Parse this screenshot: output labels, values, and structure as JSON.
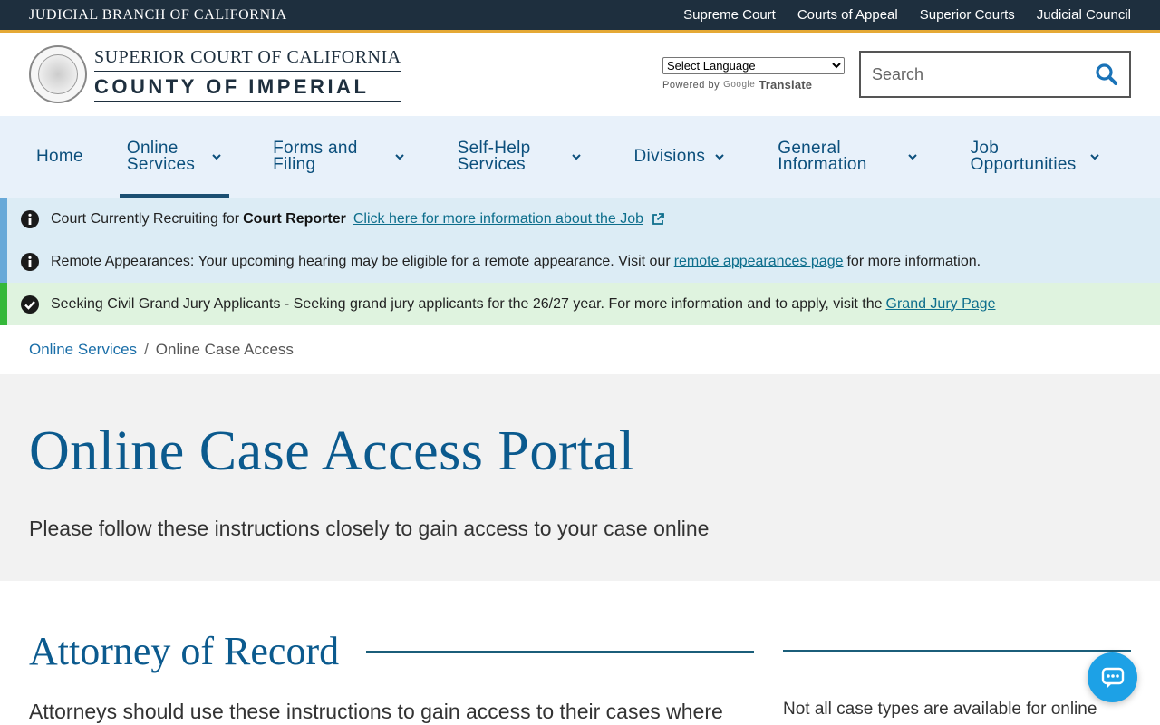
{
  "topbar": {
    "brand": "JUDICIAL BRANCH OF CALIFORNIA",
    "links": [
      "Supreme Court",
      "Courts of Appeal",
      "Superior Courts",
      "Judicial Council"
    ]
  },
  "header": {
    "logo_line1": "SUPERIOR COURT OF CALIFORNIA",
    "logo_line2": "COUNTY OF IMPERIAL",
    "seal_text": "JUDICIAL BRANCH OF CALIFORNIA",
    "language_select": "Select Language",
    "powered_by": "Powered by",
    "google": "Google",
    "translate": "Translate",
    "search_placeholder": "Search"
  },
  "nav": [
    {
      "label": "Home",
      "dropdown": false,
      "active": false
    },
    {
      "label": "Online\nServices",
      "dropdown": true,
      "active": true
    },
    {
      "label": "Forms and\nFiling",
      "dropdown": true,
      "active": false
    },
    {
      "label": "Self-Help\nServices",
      "dropdown": true,
      "active": false
    },
    {
      "label": "Divisions",
      "dropdown": true,
      "active": false
    },
    {
      "label": "General\nInformation",
      "dropdown": true,
      "active": false
    },
    {
      "label": "Job\nOpportunities",
      "dropdown": true,
      "active": false
    }
  ],
  "alerts": {
    "recruit": {
      "prefix": "Court Currently Recruiting for",
      "strong": "Court Reporter",
      "link": "Click here for more information about the Job"
    },
    "remote": {
      "prefix": "Remote Appearances: Your upcoming hearing may be eligible for a remote appearance. Visit our",
      "link": "remote appearances page",
      "suffix": "for more information."
    },
    "jury": {
      "prefix": "Seeking Civil Grand Jury Applicants - Seeking grand jury applicants for the 26/27 year. For more information and to apply, visit the",
      "link": "Grand Jury Page"
    }
  },
  "breadcrumb": {
    "parent": "Online Services",
    "separator": "/",
    "current": "Online Case Access"
  },
  "hero": {
    "title": "Online Case Access Portal",
    "subtitle": "Please follow these instructions closely to gain access to your case online"
  },
  "section": {
    "heading": "Attorney of Record",
    "body": "Attorneys should use these instructions to gain access to their cases where",
    "side_text": "Not all case types are available for online"
  },
  "colors": {
    "topbar_bg": "#1e2f3e",
    "accent_gold": "#e5a935",
    "nav_bg": "#e8f1fa",
    "link_blue": "#0b5a8e",
    "info_bg": "#dcecf5",
    "success_bg": "#dff3df",
    "chat_blue": "#1da1e6"
  },
  "icons": {
    "search": "search-icon",
    "chevron": "chevron-down-icon",
    "info": "info-circle-icon",
    "check": "check-circle-icon",
    "external": "external-link-icon",
    "chat": "chat-icon"
  }
}
